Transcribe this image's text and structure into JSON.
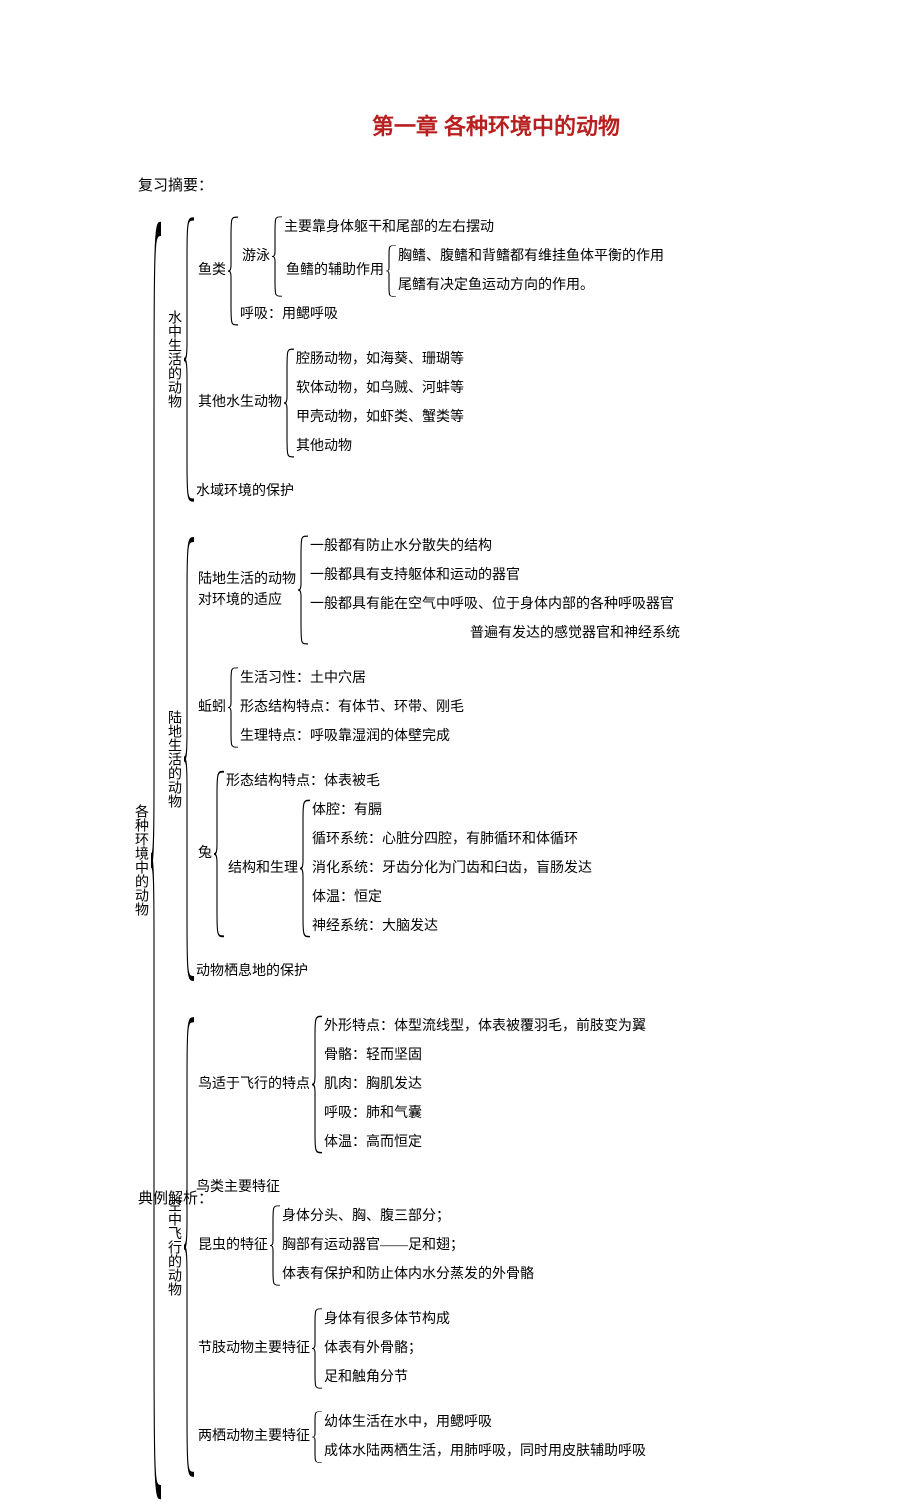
{
  "chart_data": {
    "type": "outline-tree",
    "title": "第一章 各种环境中的动物",
    "review_label": "复习摘要：",
    "example_label": "典例解析：",
    "root": {
      "label": "各种环境中的动物",
      "children": [
        {
          "label": "水中生活的动物",
          "children": [
            {
              "label": "鱼类",
              "children": [
                {
                  "label": "游泳",
                  "children": [
                    {
                      "leaf": "主要靠身体躯干和尾部的左右摆动"
                    },
                    {
                      "label": "鱼鳍的辅助作用",
                      "children": [
                        {
                          "leaf": "胸鳍、腹鳍和背鳍都有维挂鱼体平衡的作用"
                        },
                        {
                          "leaf": "尾鳍有决定鱼运动方向的作用。"
                        }
                      ]
                    }
                  ]
                },
                {
                  "leaf": "呼吸：用鳃呼吸"
                }
              ]
            },
            {
              "label": "其他水生动物",
              "children": [
                {
                  "leaf": "腔肠动物，如海葵、珊瑚等"
                },
                {
                  "leaf": "软体动物，如乌贼、河蚌等"
                },
                {
                  "leaf": "甲壳动物，如虾类、蟹类等"
                },
                {
                  "leaf": "其他动物"
                }
              ]
            },
            {
              "leaf": "水域环境的保护"
            }
          ]
        },
        {
          "label": "陆地生活的动物",
          "children": [
            {
              "label_lines": [
                "陆地生活的动物",
                "对环境的适应"
              ],
              "stack": true,
              "children": [
                {
                  "leaf": "一般都有防止水分散失的结构"
                },
                {
                  "leaf": "一般都具有支持躯体和运动的器官"
                },
                {
                  "leaf": "一般都具有能在空气中呼吸、位于身体内部的各种呼吸器官"
                },
                {
                  "leaf_indent": "普遍有发达的感觉器官和神经系统"
                }
              ]
            },
            {
              "label": "蚯蚓",
              "children": [
                {
                  "leaf": "生活习性：土中穴居"
                },
                {
                  "leaf": "形态结构特点：有体节、环带、刚毛"
                },
                {
                  "leaf": "生理特点：呼吸靠湿润的体壁完成"
                }
              ]
            },
            {
              "label": "兔",
              "children": [
                {
                  "leaf": "形态结构特点：体表被毛"
                },
                {
                  "label": "结构和生理",
                  "children": [
                    {
                      "leaf": "体腔：有膈"
                    },
                    {
                      "leaf": "循环系统：心脏分四腔，有肺循环和体循环"
                    },
                    {
                      "leaf": "消化系统：牙齿分化为门齿和臼齿，盲肠发达"
                    },
                    {
                      "leaf": "体温：恒定"
                    },
                    {
                      "leaf": "神经系统：大脑发达"
                    }
                  ]
                }
              ]
            },
            {
              "leaf": "动物栖息地的保护"
            }
          ]
        },
        {
          "label": "空中飞行的动物",
          "children": [
            {
              "label": "鸟适于飞行的特点",
              "children": [
                {
                  "leaf": "外形特点：体型流线型，体表被覆羽毛，前肢变为翼"
                },
                {
                  "leaf": "骨骼：轻而坚固"
                },
                {
                  "leaf": "肌肉：胸肌发达"
                },
                {
                  "leaf": "呼吸：肺和气囊"
                },
                {
                  "leaf": "体温：高而恒定"
                }
              ]
            },
            {
              "leaf": "鸟类主要特征"
            },
            {
              "label": "昆虫的特征",
              "children": [
                {
                  "leaf": "身体分头、胸、腹三部分；"
                },
                {
                  "leaf": "胸部有运动器官——足和翅；"
                },
                {
                  "leaf": "体表有保护和防止体内水分蒸发的外骨骼"
                }
              ]
            },
            {
              "label": "节肢动物主要特征",
              "children": [
                {
                  "leaf": "身体有很多体节构成"
                },
                {
                  "leaf": "体表有外骨骼；"
                },
                {
                  "leaf": "足和触角分节"
                }
              ]
            },
            {
              "label": "两栖动物主要特征",
              "children": [
                {
                  "leaf": "幼体生活在水中，用鳃呼吸"
                },
                {
                  "leaf": "成体水陆两栖生活，用肺呼吸，同时用皮肤辅助呼吸"
                }
              ]
            }
          ]
        }
      ]
    }
  }
}
